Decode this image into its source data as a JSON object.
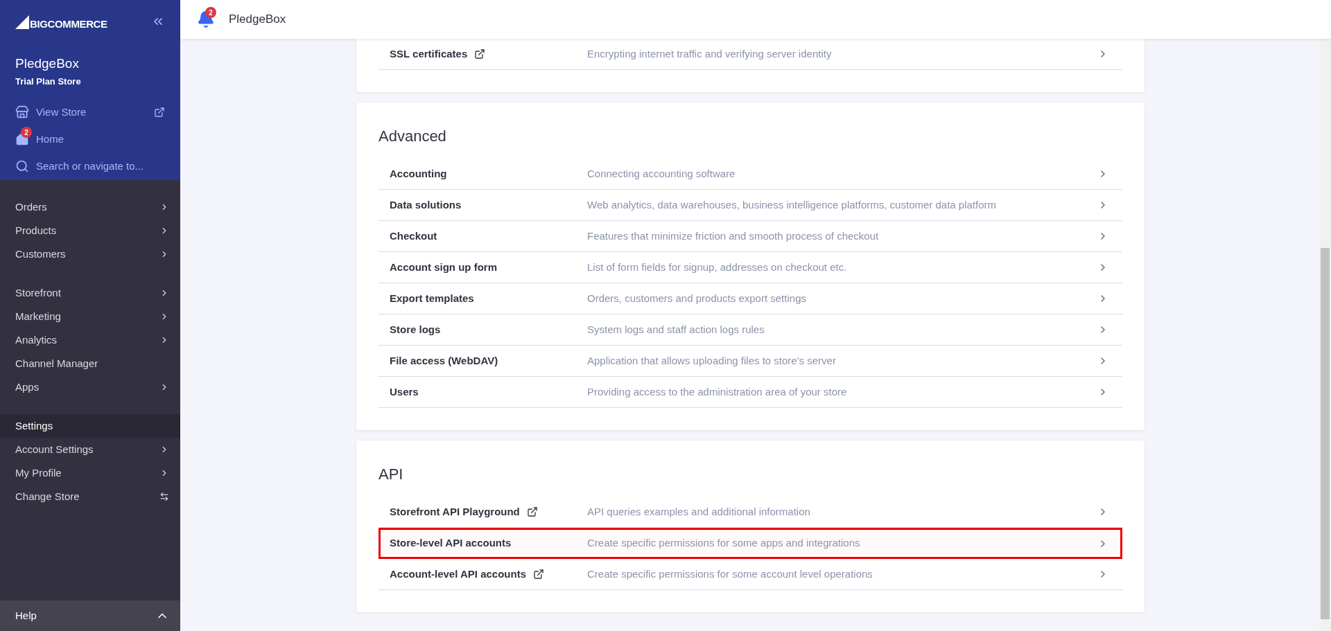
{
  "sidebar": {
    "logo": "BIGCOMMERCE",
    "store_name": "PledgeBox",
    "store_plan": "Trial Plan Store",
    "links": [
      {
        "kind": "store",
        "label": "View Store",
        "external": true
      },
      {
        "kind": "home",
        "label": "Home",
        "badge": "2",
        "external": false
      },
      {
        "kind": "search",
        "label": "Search or navigate to...",
        "external": false
      }
    ],
    "nav_groups": [
      [
        {
          "label": "Orders",
          "kind": "submenu",
          "selected": false
        },
        {
          "label": "Products",
          "kind": "submenu",
          "selected": false
        },
        {
          "label": "Customers",
          "kind": "submenu",
          "selected": false
        }
      ],
      [
        {
          "label": "Storefront",
          "kind": "submenu",
          "selected": false
        },
        {
          "label": "Marketing",
          "kind": "submenu",
          "selected": false
        },
        {
          "label": "Analytics",
          "kind": "submenu",
          "selected": false
        },
        {
          "label": "Channel Manager",
          "kind": "plain",
          "selected": false
        },
        {
          "label": "Apps",
          "kind": "submenu",
          "selected": false
        }
      ],
      [
        {
          "label": "Settings",
          "kind": "plain",
          "selected": true
        },
        {
          "label": "Account Settings",
          "kind": "submenu",
          "selected": false
        },
        {
          "label": "My Profile",
          "kind": "submenu",
          "selected": false
        },
        {
          "label": "Change Store",
          "kind": "switcher",
          "selected": false
        }
      ]
    ],
    "help": {
      "label": "Help",
      "expanded": true
    }
  },
  "header": {
    "notification_count": "2",
    "title": "PledgeBox"
  },
  "sections": [
    {
      "rows": [
        {
          "label": "SSL certificates",
          "external": true,
          "description": "Encrypting internet traffic and verifying server identity",
          "highlighted": false
        }
      ]
    },
    {
      "title": "Advanced",
      "rows": [
        {
          "label": "Accounting",
          "external": false,
          "description": "Connecting accounting software",
          "highlighted": false
        },
        {
          "label": "Data solutions",
          "external": false,
          "description": "Web analytics, data warehouses, business intelligence platforms, customer data platform",
          "highlighted": false
        },
        {
          "label": "Checkout",
          "external": false,
          "description": "Features that minimize friction and smooth process of checkout",
          "highlighted": false
        },
        {
          "label": "Account sign up form",
          "external": false,
          "description": "List of form fields for signup, addresses on checkout etc.",
          "highlighted": false
        },
        {
          "label": "Export templates",
          "external": false,
          "description": "Orders, customers and products export settings",
          "highlighted": false
        },
        {
          "label": "Store logs",
          "external": false,
          "description": "System logs and staff action logs rules",
          "highlighted": false
        },
        {
          "label": "File access (WebDAV)",
          "external": false,
          "description": "Application that allows uploading files to store's server",
          "highlighted": false
        },
        {
          "label": "Users",
          "external": false,
          "description": "Providing access to the administration area of your store",
          "highlighted": false
        }
      ]
    },
    {
      "title": "API",
      "rows": [
        {
          "label": "Storefront API Playground",
          "external": true,
          "description": "API queries examples and additional information",
          "highlighted": false
        },
        {
          "label": "Store-level API accounts",
          "external": false,
          "description": "Create specific permissions for some apps and integrations",
          "highlighted": true
        },
        {
          "label": "Account-level API accounts",
          "external": true,
          "description": "Create specific permissions for some account level operations",
          "highlighted": false
        }
      ]
    }
  ]
}
